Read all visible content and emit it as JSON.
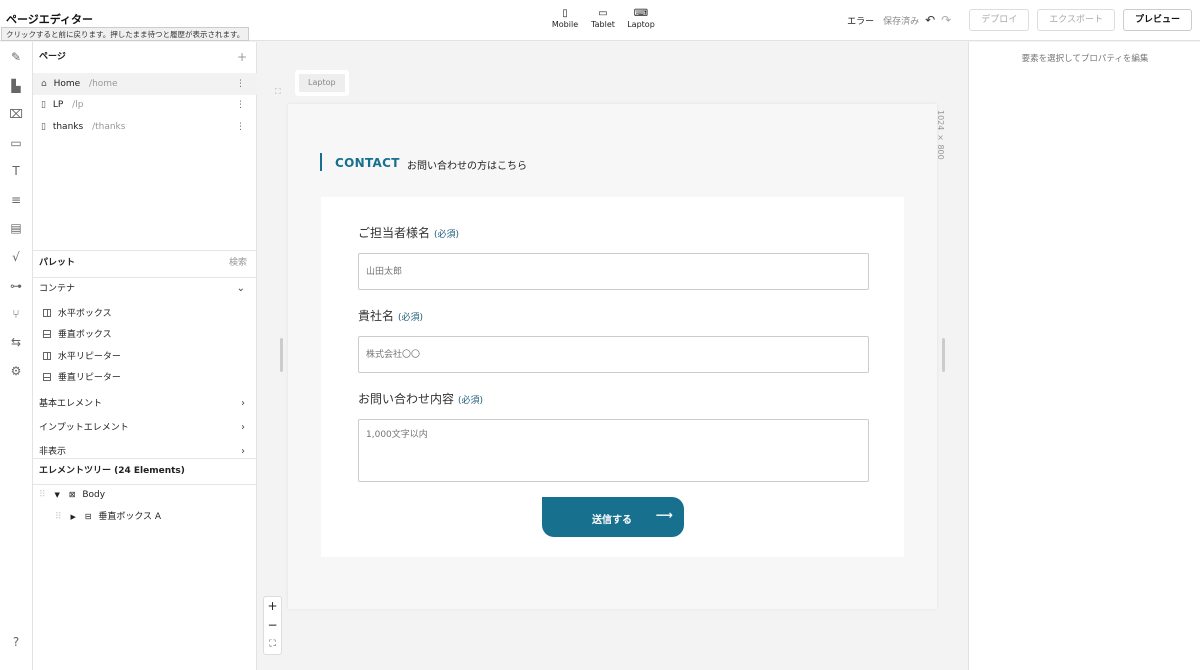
{
  "app": {
    "title": "ページエディター",
    "tooltip": "クリックすると前に戻ります。押したまま待つと履歴が表示されます。"
  },
  "devices": [
    {
      "label": "Mobile",
      "icon": "mobile-icon"
    },
    {
      "label": "Tablet",
      "icon": "tablet-icon"
    },
    {
      "label": "Laptop",
      "icon": "laptop-icon"
    }
  ],
  "toolbar": {
    "status_error": "エラー",
    "status_saved": "保存済み",
    "deploy_label": "デプロイ",
    "export_label": "エクスポート",
    "preview_label": "プレビュー"
  },
  "rail_icons": [
    "magic-tools-icon",
    "paint-roller-icon",
    "frame-icon",
    "monitor-icon",
    "text-size-icon",
    "database-icon",
    "folders-icon",
    "formula-icon",
    "flow-icon",
    "branch-icon",
    "translate-icon",
    "settings-icon",
    "help-icon"
  ],
  "pages": {
    "header": "ページ",
    "add_label": "+",
    "items": [
      {
        "name": "Home",
        "path": "/home",
        "icon": "home-icon",
        "active": true
      },
      {
        "name": "LP",
        "path": "/lp",
        "icon": "file-icon",
        "active": false
      },
      {
        "name": "thanks",
        "path": "/thanks",
        "icon": "file-icon",
        "active": false
      }
    ]
  },
  "palette": {
    "header": "パレット",
    "search_label": "検索",
    "sections": [
      {
        "label": "コンテナ",
        "expanded": true
      },
      {
        "label": "基本エレメント",
        "expanded": false
      },
      {
        "label": "インプットエレメント",
        "expanded": false
      },
      {
        "label": "非表示",
        "expanded": false
      }
    ],
    "container_items": [
      {
        "label": "水平ボックス",
        "icon": "hbox-icon"
      },
      {
        "label": "垂直ボックス",
        "icon": "vbox-icon"
      },
      {
        "label": "水平リピーター",
        "icon": "hbox-icon"
      },
      {
        "label": "垂直リピーター",
        "icon": "vbox-icon"
      }
    ]
  },
  "tree": {
    "header": "エレメントツリー (24 Elements)",
    "nodes": [
      {
        "label": "Body",
        "icon": "body-icon"
      },
      {
        "label": "垂直ボックス A",
        "icon": "vbox-icon"
      }
    ]
  },
  "canvas": {
    "viewport_label": "Laptop",
    "size_label": "1024 × 800",
    "zoom_in": "+",
    "zoom_out": "−",
    "fit": "⛶"
  },
  "form": {
    "section_title": "CONTACT",
    "section_subtitle": "お問い合わせの方はこちら",
    "required_text": "(必須)",
    "fields": [
      {
        "label": "ご担当者様名",
        "value": "山田太郎"
      },
      {
        "label": "貴社名",
        "value": "株式会社〇〇"
      },
      {
        "label": "お問い合わせ内容",
        "value": "1,000文字以内"
      }
    ],
    "submit_label": "送信する",
    "submit_arrow": "⟶"
  },
  "properties": {
    "hint": "要素を選択してプロパティを編集"
  }
}
